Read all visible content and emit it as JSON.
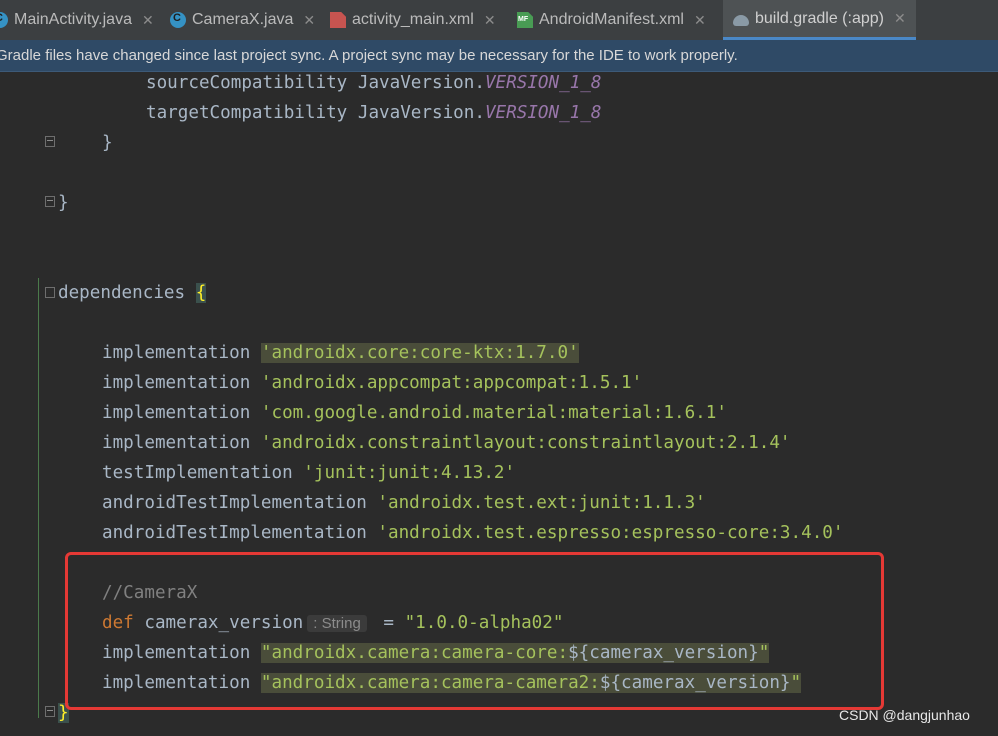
{
  "tabs": [
    {
      "label": "MainActivity.java",
      "icon": "java-class-icon"
    },
    {
      "label": "CameraX.java",
      "icon": "java-class-icon"
    },
    {
      "label": "activity_main.xml",
      "icon": "xml-file-icon"
    },
    {
      "label": "AndroidManifest.xml",
      "icon": "manifest-file-icon"
    },
    {
      "label": "build.gradle (:app)",
      "icon": "gradle-icon",
      "active": true
    }
  ],
  "close_glyph": "✕",
  "banner": "Gradle files have changed since last project sync. A project sync may be necessary for the IDE to work properly.",
  "code": {
    "source_compat": {
      "prefix": "sourceCompatibility JavaVersion.",
      "value": "VERSION_1_8"
    },
    "target_compat": {
      "prefix": "targetCompatibility JavaVersion.",
      "value": "VERSION_1_8"
    },
    "close_brace_inner": "}",
    "close_brace_outer": "}",
    "deps_keyword": "dependencies ",
    "deps_open": "{",
    "impl1": {
      "kw": "implementation ",
      "str": "'androidx.core:core-ktx:1.7.0'"
    },
    "impl2": {
      "kw": "implementation ",
      "str": "'androidx.appcompat:appcompat:1.5.1'"
    },
    "impl3": {
      "kw": "implementation ",
      "str": "'com.google.android.material:material:1.6.1'"
    },
    "impl4": {
      "kw": "implementation ",
      "str": "'androidx.constraintlayout:constraintlayout:2.1.4'"
    },
    "test1": {
      "kw": "testImplementation ",
      "str": "'junit:junit:4.13.2'"
    },
    "test2": {
      "kw": "androidTestImplementation ",
      "str": "'androidx.test.ext:junit:1.1.3'"
    },
    "test3": {
      "kw": "androidTestImplementation ",
      "str": "'androidx.test.espresso:espresso-core:3.4.0'"
    },
    "comment": "//CameraX",
    "def_kw": "def ",
    "def_name": "camerax_version",
    "def_hint": ": String",
    "def_eq": " = ",
    "def_value": "\"1.0.0-alpha02\"",
    "cam1": {
      "kw": "implementation ",
      "str": "\"androidx.camera:camera-core:",
      "tmpl": "${camerax_version}",
      "end": "\""
    },
    "cam2": {
      "kw": "implementation ",
      "str": "\"androidx.camera:camera-camera2:",
      "tmpl": "${camerax_version}",
      "end": "\""
    },
    "deps_close": "}"
  },
  "watermark": "CSDN @dangjunhao",
  "colors": {
    "accent": "#4a88c7",
    "highlight_box": "#e53935",
    "string": "#a5c25c",
    "keyword": "#cc7832"
  }
}
